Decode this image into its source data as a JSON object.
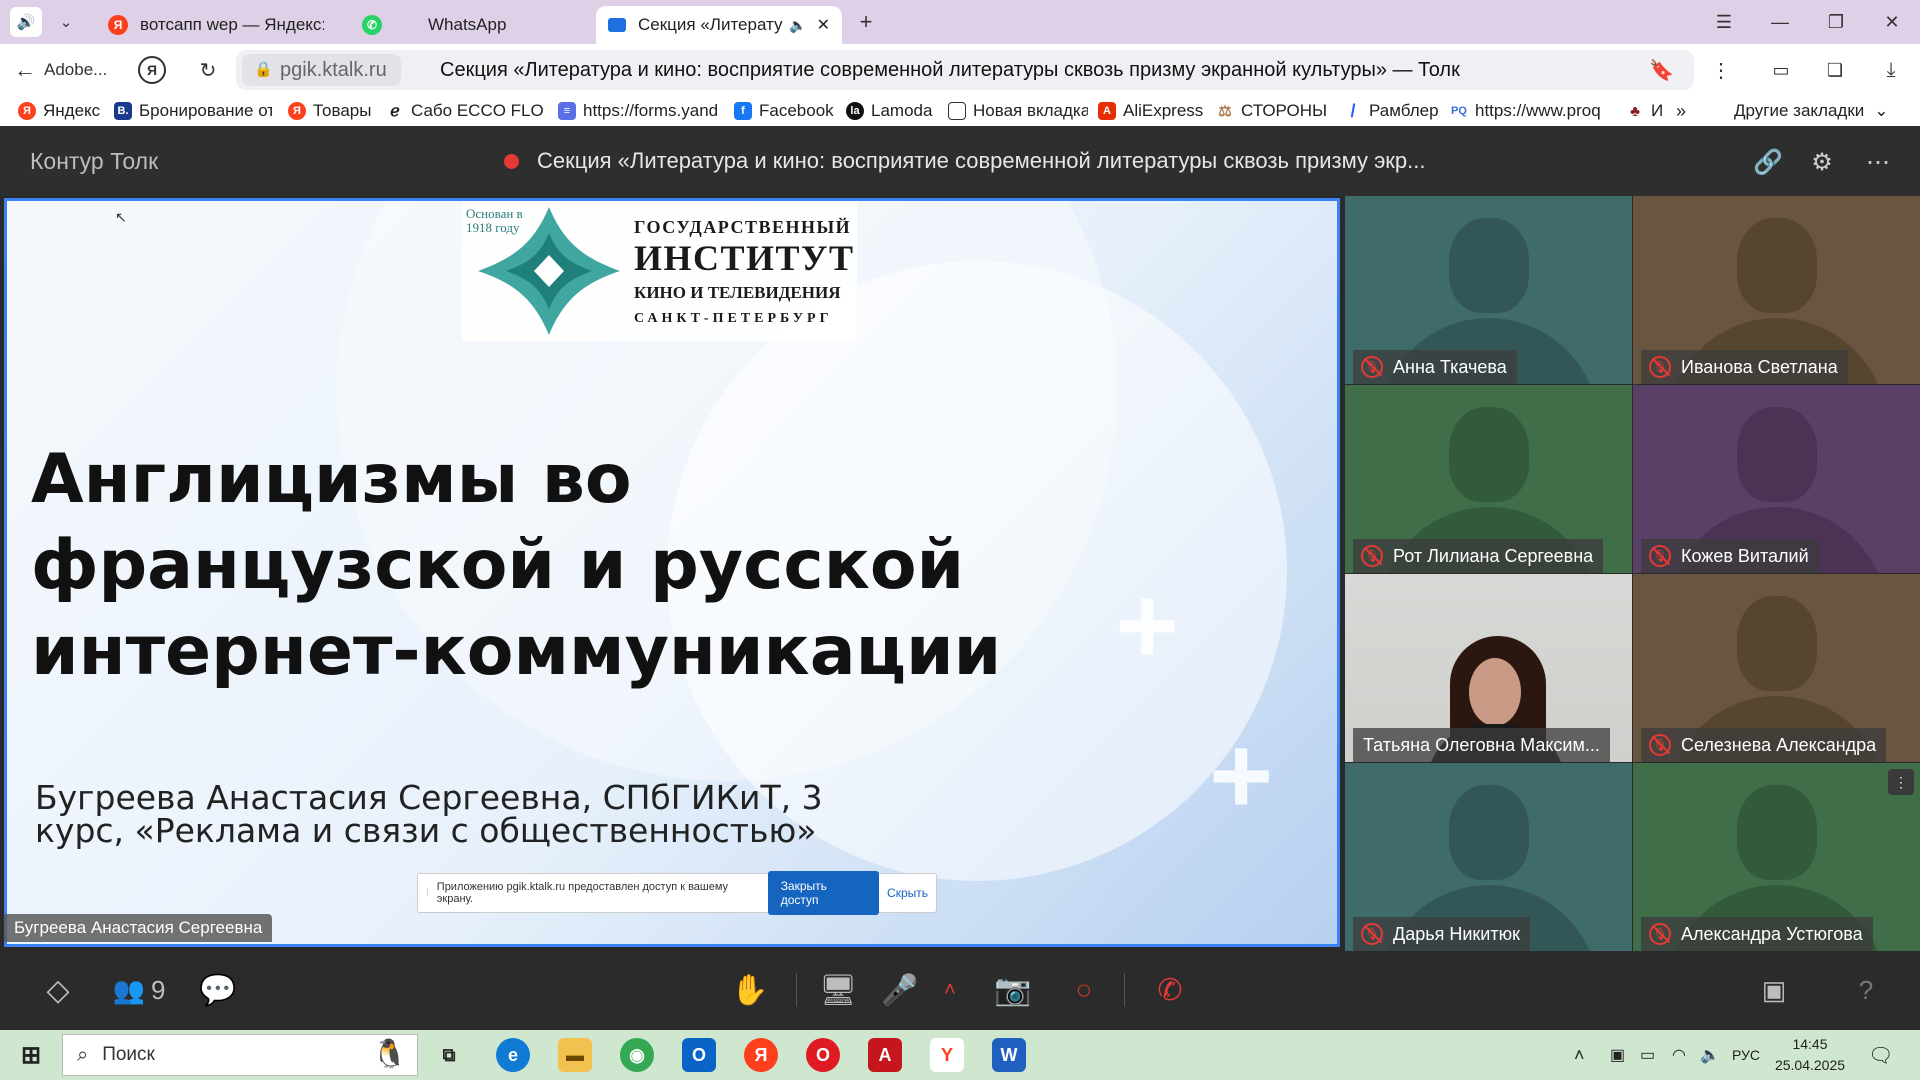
{
  "browser": {
    "tabs": [
      {
        "label": "вотсапп wep — Яндекс: на",
        "favicon": "yandex-icon"
      },
      {
        "label": "WhatsApp",
        "favicon": "whatsapp-icon"
      },
      {
        "label": "Секция «Литератур",
        "favicon": "video-icon",
        "active": true
      }
    ],
    "back_label": "Adobe...",
    "domain": "pgik.ktalk.ru",
    "page_title": "Секция «Литература и кино: восприятие современной литературы сквозь призму экранной культуры» — Толк",
    "bookmarks": [
      {
        "label": "Яндекс",
        "color": "#fc3f1d",
        "glyph": "Я"
      },
      {
        "label": "Бронирование от",
        "color": "#1a3b8c",
        "glyph": "B."
      },
      {
        "label": "Товары",
        "color": "#fc3f1d",
        "glyph": "Я"
      },
      {
        "label": "Сабо ECCO FLOW",
        "color": "#222222",
        "glyph": "e"
      },
      {
        "label": "https://forms.yand",
        "color": "#5a6ee8",
        "glyph": "≡"
      },
      {
        "label": "Facebook",
        "color": "#1877f2",
        "glyph": "f"
      },
      {
        "label": "Lamoda",
        "color": "#111111",
        "glyph": "la"
      },
      {
        "label": "Новая вкладка",
        "color": "#ffffff",
        "glyph": "▯"
      },
      {
        "label": "AliExpress",
        "color": "#e62e04",
        "glyph": "A"
      },
      {
        "label": "СТОРОНЫ",
        "color": "#c9a27a",
        "glyph": "⚖"
      },
      {
        "label": "Рамблер",
        "color": "#315efb",
        "glyph": "/"
      },
      {
        "label": "https://www.proq",
        "color": "#3b6fd8",
        "glyph": "PQ"
      },
      {
        "label": "И",
        "color": "#8b1d1d",
        "glyph": "♣"
      }
    ],
    "other_bookmarks": "Другие закладки"
  },
  "app": {
    "brand": "Контур Толк",
    "meeting_title": "Секция «Литература и кино: восприятие современной литературы сквозь призму экр..."
  },
  "slide": {
    "logo_founded": "Основан в 1918 году",
    "logo_line1": "ГОСУДАРСТВЕННЫЙ",
    "logo_line2": "ИНСТИТУТ",
    "logo_line3": "КИНО И ТЕЛЕВИДЕНИЯ",
    "logo_line4": "САНКТ-ПЕТЕРБУРГ",
    "title": "Англицизмы во французской и русской интернет-коммуникации",
    "author": "Бугреева Анастасия Сергеевна, СПбГИКиТ, 3 курс, «Реклама и связи с общественностью»",
    "speaker_label": "Бугреева Анастасия Сергеевна",
    "share_notice": "Приложению pgik.ktalk.ru предоставлен доступ к вашему экрану.",
    "share_stop": "Закрыть доступ",
    "share_hide": "Скрыть"
  },
  "participants": [
    {
      "name": "Анна Ткачева",
      "bg": "#3f6b6b",
      "muted": true
    },
    {
      "name": "Иванова Светлана",
      "bg": "#6a5640",
      "muted": true
    },
    {
      "name": "Рот Лилиана Сергеевна",
      "bg": "#3f6e48",
      "muted": true
    },
    {
      "name": "Кожев Виталий",
      "bg": "#5a3f66",
      "muted": true
    },
    {
      "name": "Татьяна Олеговна Максим...",
      "bg": "video",
      "muted": false
    },
    {
      "name": "Селезнева Александра",
      "bg": "#6a5640",
      "muted": true
    },
    {
      "name": "Дарья Никитюк",
      "bg": "#3f6b6b",
      "muted": true
    },
    {
      "name": "Александра Устюгова",
      "bg": "#3f6e48",
      "muted": true
    }
  ],
  "toolbar": {
    "participants_count": "9"
  },
  "taskbar": {
    "search_placeholder": "Поиск",
    "lang": "РУС",
    "time": "14:45",
    "date": "25.04.2025"
  }
}
